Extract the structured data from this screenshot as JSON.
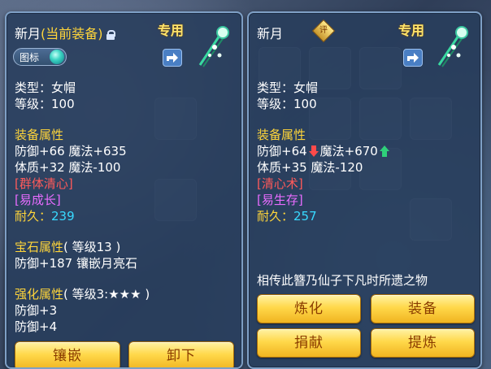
{
  "left": {
    "name": "新月",
    "current_tag": "(当前装备)",
    "dedicated": "专用",
    "badge": "图标",
    "type": "类型：女帽",
    "level": "等级：100",
    "section_attr": "装备属性",
    "attr1": "防御+66 魔法+635",
    "attr2": "体质+32 魔法-100",
    "skill1": "[群体清心]",
    "skill2": "[易成长]",
    "durability_label": "耐久：",
    "durability_value": "239",
    "gem_title": "宝石属性",
    "gem_level": "( 等级13 )",
    "gem_effect": "防御+187 镶嵌月亮石",
    "enhance_title": "强化属性",
    "enhance_level": "( 等级3:★★★ )",
    "enhance1": "防御+3",
    "enhance2": "防御+4",
    "btn_inlay": "镶嵌",
    "btn_unequip": "卸下"
  },
  "right": {
    "name": "新月",
    "rating": "评",
    "dedicated": "专用",
    "type": "类型：女帽",
    "level": "等级：100",
    "section_attr": "装备属性",
    "attr1_a": "防御+64",
    "attr1_b": "魔法+670",
    "attr2": "体质+35 魔法-120",
    "skill1": "[清心术]",
    "skill2": "[易生存]",
    "durability_label": "耐久：",
    "durability_value": "257",
    "description": "相传此簪乃仙子下凡时所遗之物",
    "btn_refine": "炼化",
    "btn_equip": "装备",
    "btn_donate": "捐献",
    "btn_extract": "提炼"
  },
  "icons": [
    "lock-icon",
    "share-icon",
    "hairpin-item-icon",
    "orb-icon",
    "rating-icon",
    "arrow-down-icon",
    "arrow-up-icon"
  ],
  "colors": {
    "yellow": "#ffd53a",
    "red": "#ff5a5a",
    "magenta": "#e86cff",
    "cyan": "#38d9ff",
    "button": "#ffd84a"
  }
}
